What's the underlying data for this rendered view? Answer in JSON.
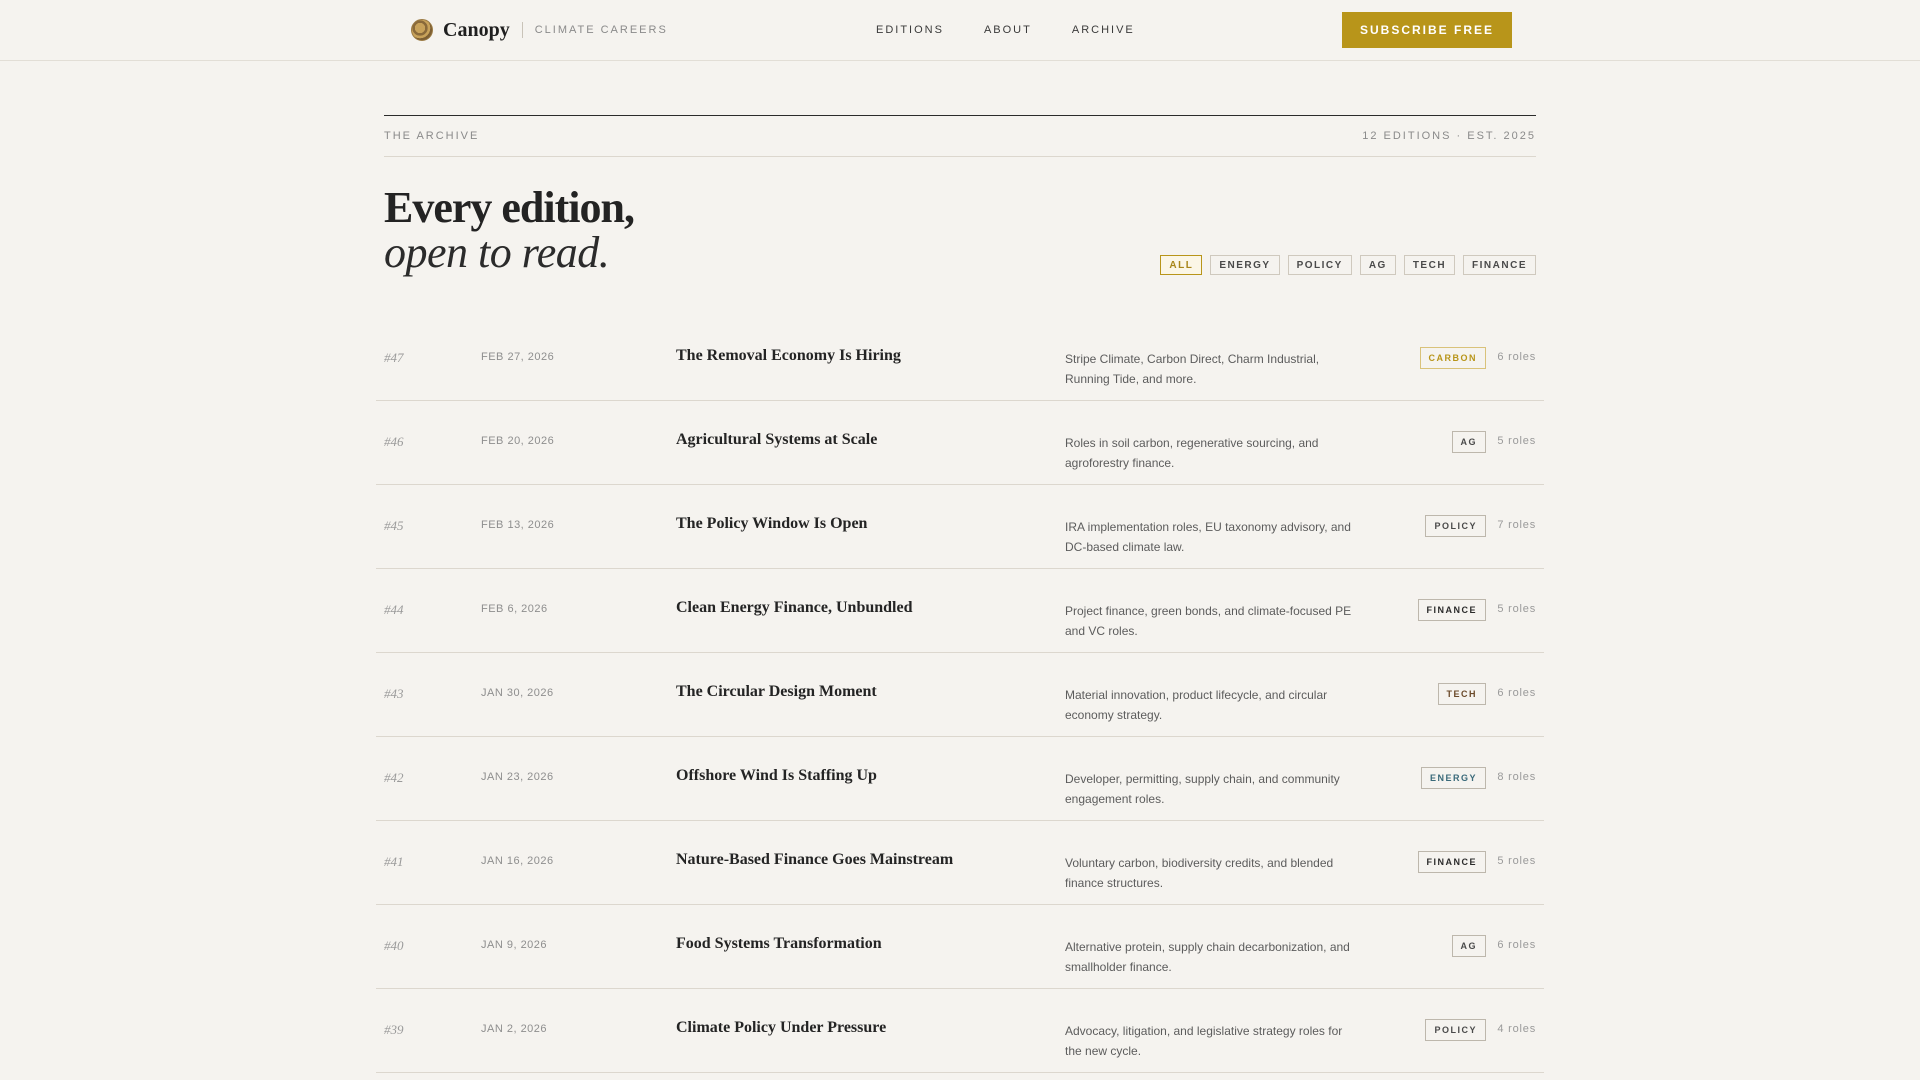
{
  "header": {
    "brand": "Canopy",
    "tagline": "CLIMATE CAREERS",
    "nav": [
      "EDITIONS",
      "ABOUT",
      "ARCHIVE"
    ],
    "subscribe_label": "SUBSCRIBE FREE"
  },
  "archive": {
    "label": "THE ARCHIVE",
    "meta": "12 EDITIONS · EST. 2025",
    "headline_line1": "Every edition,",
    "headline_line2": "open to read."
  },
  "filters": [
    "ALL",
    "ENERGY",
    "POLICY",
    "AG",
    "TECH",
    "FINANCE"
  ],
  "active_filter": "ALL",
  "colors": {
    "accent": "#b8951a",
    "carbon": "#b8951a",
    "ag": "#4a4a4a",
    "policy": "#4a4a4a",
    "finance": "#2b2b2b",
    "tech": "#6b4a2a",
    "energy": "#3a6a7a"
  },
  "editions": [
    {
      "num": "#47",
      "date": "FEB 27, 2026",
      "title": "The Removal Economy Is Hiring",
      "desc": "Stripe Climate, Carbon Direct, Charm Industrial, Running Tide, and more.",
      "tag": "CARBON",
      "tag_color": "#b8951a",
      "roles": "6 roles"
    },
    {
      "num": "#46",
      "date": "FEB 20, 2026",
      "title": "Agricultural Systems at Scale",
      "desc": "Roles in soil carbon, regenerative sourcing, and agroforestry finance.",
      "tag": "AG",
      "tag_color": "#4a4a4a",
      "roles": "5 roles"
    },
    {
      "num": "#45",
      "date": "FEB 13, 2026",
      "title": "The Policy Window Is Open",
      "desc": "IRA implementation roles, EU taxonomy advisory, and DC-based climate law.",
      "tag": "POLICY",
      "tag_color": "#4a4a4a",
      "roles": "7 roles"
    },
    {
      "num": "#44",
      "date": "FEB 6, 2026",
      "title": "Clean Energy Finance, Unbundled",
      "desc": "Project finance, green bonds, and climate-focused PE and VC roles.",
      "tag": "FINANCE",
      "tag_color": "#2b2b2b",
      "roles": "5 roles"
    },
    {
      "num": "#43",
      "date": "JAN 30, 2026",
      "title": "The Circular Design Moment",
      "desc": "Material innovation, product lifecycle, and circular economy strategy.",
      "tag": "TECH",
      "tag_color": "#6b4a2a",
      "roles": "6 roles"
    },
    {
      "num": "#42",
      "date": "JAN 23, 2026",
      "title": "Offshore Wind Is Staffing Up",
      "desc": "Developer, permitting, supply chain, and community engagement roles.",
      "tag": "ENERGY",
      "tag_color": "#3a6a7a",
      "roles": "8 roles"
    },
    {
      "num": "#41",
      "date": "JAN 16, 2026",
      "title": "Nature-Based Finance Goes Mainstream",
      "desc": "Voluntary carbon, biodiversity credits, and blended finance structures.",
      "tag": "FINANCE",
      "tag_color": "#2b2b2b",
      "roles": "5 roles"
    },
    {
      "num": "#40",
      "date": "JAN 9, 2026",
      "title": "Food Systems Transformation",
      "desc": "Alternative protein, supply chain decarbonization, and smallholder finance.",
      "tag": "AG",
      "tag_color": "#4a4a4a",
      "roles": "6 roles"
    },
    {
      "num": "#39",
      "date": "JAN 2, 2026",
      "title": "Climate Policy Under Pressure",
      "desc": "Advocacy, litigation, and legislative strategy roles for the new cycle.",
      "tag": "POLICY",
      "tag_color": "#4a4a4a",
      "roles": "4 roles"
    }
  ]
}
